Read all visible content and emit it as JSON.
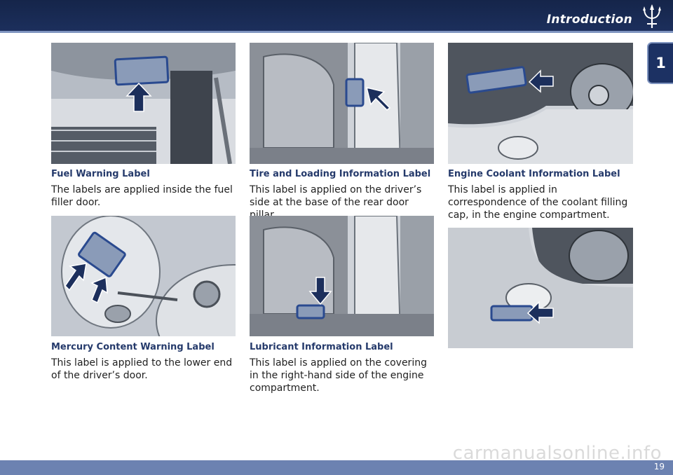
{
  "header": {
    "title": "Introduction",
    "logo": "trident-logo-icon"
  },
  "chapter_tab": {
    "number": "1"
  },
  "footer": {
    "page_number": "19",
    "watermark": "carmanualsonline.info"
  },
  "colors": {
    "navy": "#1c2f5c",
    "caption_blue": "#253a6b",
    "bar_blue": "#6c82b1",
    "arrow": "#1c2f5c"
  },
  "sections": {
    "fuel": {
      "title": "Fuel Warning Label",
      "text": "The labels are applied inside the fuel filler door.",
      "image_icon": "engine-hood-photo"
    },
    "mercury": {
      "title": "Mercury Content Warning Label",
      "text": "This label is applied to the lower end of the driver’s door.",
      "image_icon": "fuel-door-photo"
    },
    "tire": {
      "title": "Tire and Loading Information Label",
      "text": "This label is applied on the driver’s side at the base of the rear door pillar.",
      "image_icon": "door-pillar-photo"
    },
    "lubricant": {
      "title": "Lubricant Information Label",
      "text": "This label is applied on the covering in the right-hand side of the engine compartment.",
      "image_icon": "door-sill-photo"
    },
    "coolant": {
      "title": "Engine Coolant Information Label",
      "text": "This label is applied in correspondence of the coolant filling cap, in the engine compartment.",
      "image_icon": "engine-bay-photo"
    }
  }
}
